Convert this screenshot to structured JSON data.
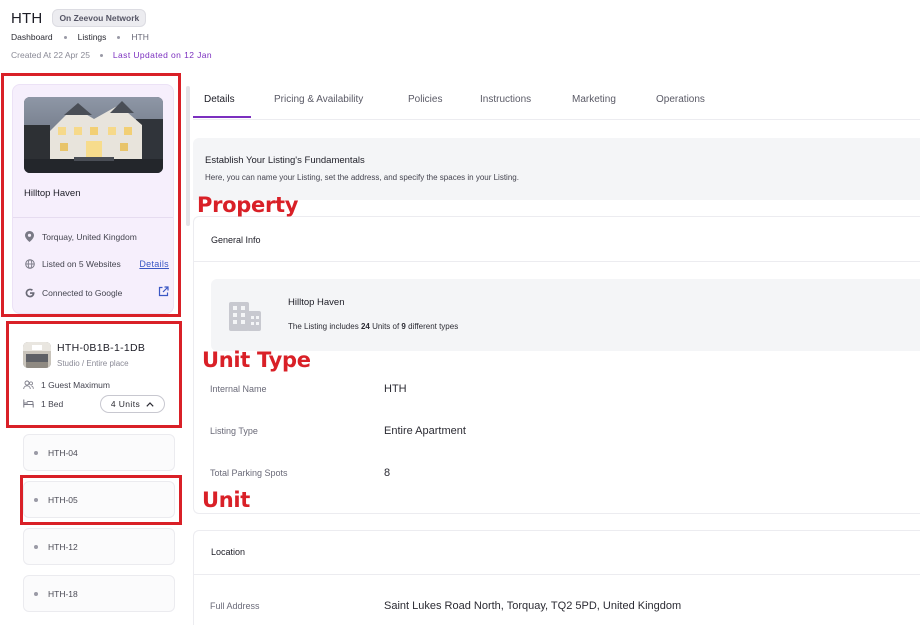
{
  "header": {
    "title": "HTH",
    "network_badge": "On Zeevou Network",
    "breadcrumb": [
      "Dashboard",
      "Listings",
      "HTH"
    ],
    "created": "Created At 22 Apr 25",
    "updated": "Last Updated on 12 Jan"
  },
  "property": {
    "name": "Hilltop Haven",
    "location": "Torquay, United Kingdom",
    "listed_on": "Listed on 5 Websites",
    "details_link": "Details",
    "google": "Connected to Google"
  },
  "unit_type": {
    "code": "HTH-0B1B-1-1DB",
    "subtitle": "Studio / Entire place",
    "guests": "1 Guest Maximum",
    "beds": "1 Bed",
    "units_toggle": "4 Units"
  },
  "units": [
    "HTH-04",
    "HTH-05",
    "HTH-12",
    "HTH-18"
  ],
  "annotations": {
    "property": "Property",
    "unit_type": "Unit Type",
    "unit": "Unit",
    "color": "#d92027"
  },
  "tabs": [
    "Details",
    "Pricing & Availability",
    "Policies",
    "Instructions",
    "Marketing",
    "Operations"
  ],
  "active_tab": "Details",
  "fundamentals": {
    "title": "Establish Your Listing's Fundamentals",
    "description": "Here, you can name your Listing, set the address, and specify the spaces in your Listing."
  },
  "general_info": {
    "heading": "General Info",
    "summary_name": "Hilltop Haven",
    "summary_prefix": "The Listing includes ",
    "summary_units": "24",
    "summary_middle": " Units of ",
    "summary_types": "9",
    "summary_suffix": " different types",
    "fields": [
      {
        "label": "Internal Name",
        "value": "HTH"
      },
      {
        "label": "Listing Type",
        "value": "Entire Apartment"
      },
      {
        "label": "Total Parking Spots",
        "value": "8"
      }
    ]
  },
  "location": {
    "heading": "Location",
    "address_label": "Full Address",
    "address_value": "Saint Lukes Road North, Torquay, TQ2 5PD, United Kingdom"
  },
  "colors": {
    "accent": "#7b2fbf",
    "link": "#3a57c4",
    "property_card_bg": "#f6effc"
  }
}
